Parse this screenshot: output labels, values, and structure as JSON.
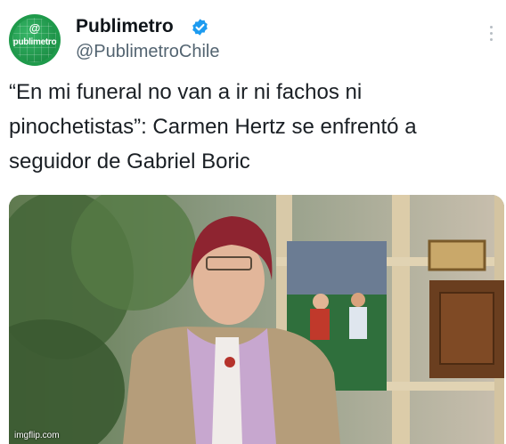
{
  "account": {
    "name": "Publimetro",
    "handle": "@PublimetroChile",
    "avatar_at": "@",
    "avatar_word": "publimetro",
    "verified_icon": "verified-badge-icon",
    "verified_color": "#1d9bf0"
  },
  "menu": {
    "icon": "more-options-icon"
  },
  "tweet": {
    "text": "“En mi funeral no van a ir ni fachos ni pinochetistas”: Carmen Hertz se enfrentó a seguidor de Gabriel Boric"
  },
  "media": {
    "kind": "photo"
  },
  "watermark": "imgflip.com",
  "colors": {
    "brand_green": "#1f9a4b",
    "text": "#0f1419",
    "secondary": "#536471"
  }
}
